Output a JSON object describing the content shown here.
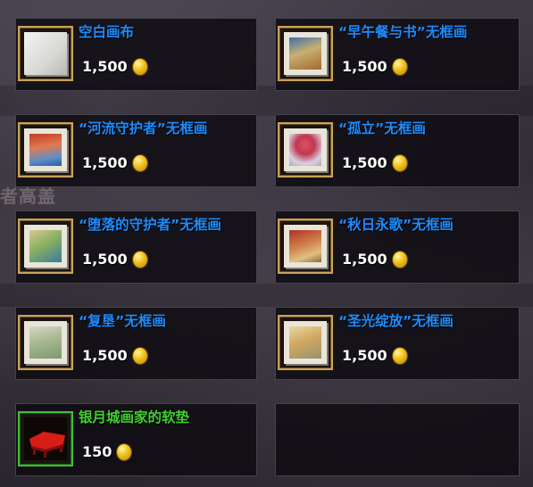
{
  "background_text": "者高盖",
  "items": [
    {
      "name": "空白画布",
      "price": "1,500",
      "quality": "blue",
      "icon": "blank-canvas-icon"
    },
    {
      "name": "“早午餐与书”无框画",
      "price": "1,500",
      "quality": "blue",
      "icon": "painting-icon"
    },
    {
      "name": "“河流守护者”无框画",
      "price": "1,500",
      "quality": "blue",
      "icon": "painting-icon"
    },
    {
      "name": "“孤立”无框画",
      "price": "1,500",
      "quality": "blue",
      "icon": "painting-icon"
    },
    {
      "name": "“堕落的守护者”无框画",
      "price": "1,500",
      "quality": "blue",
      "icon": "painting-icon"
    },
    {
      "name": "“秋日永歌”无框画",
      "price": "1,500",
      "quality": "blue",
      "icon": "painting-icon"
    },
    {
      "name": "“复垦”无框画",
      "price": "1,500",
      "quality": "blue",
      "icon": "painting-icon"
    },
    {
      "name": "“圣光绽放”无框画",
      "price": "1,500",
      "quality": "blue",
      "icon": "painting-icon"
    },
    {
      "name": "银月城画家的软垫",
      "price": "150",
      "quality": "green",
      "icon": "cushion-icon"
    }
  ],
  "colors": {
    "rare_name": "#1d8cff",
    "common_name": "#40d02e",
    "price": "#ffffff",
    "coin": "#f3c522"
  }
}
